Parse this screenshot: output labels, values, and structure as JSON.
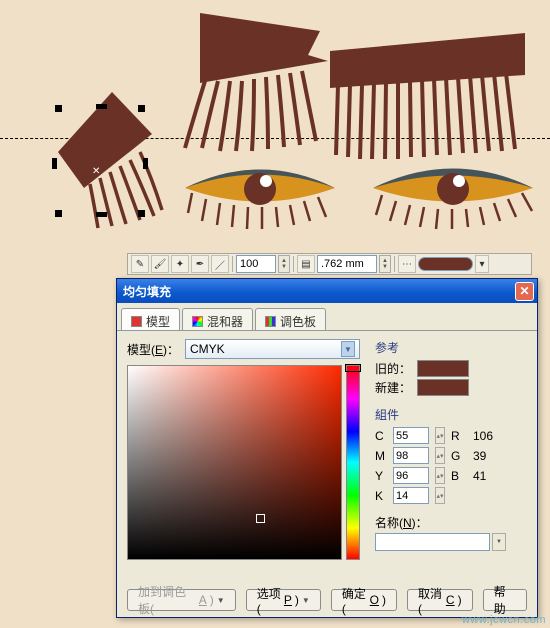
{
  "toolbar": {
    "val1": "100",
    "val2": ".762 mm",
    "swatch_color": "#6a3227"
  },
  "dialog": {
    "title": "均匀填充",
    "tabs": {
      "model": "模型",
      "mixer": "混和器",
      "palette": "调色板"
    },
    "model_label": "模型(E)：",
    "model_value": "CMYK",
    "ref_section": "参考",
    "old_label": "旧的：",
    "new_label": "新建：",
    "comp_section": "組件",
    "c_label": "C",
    "c_val": "55",
    "m_label": "M",
    "m_val": "98",
    "y_label": "Y",
    "y_val": "96",
    "k_label": "K",
    "k_val": "14",
    "r_label": "R",
    "r_val": "106",
    "g_label": "G",
    "g_val": "39",
    "b_label": "B",
    "b_val": "41",
    "name_label": "名称(N)：",
    "btn_addpalette": "加到调色板(A)",
    "btn_options": "选项(P)",
    "btn_ok": "确定(O)",
    "btn_cancel": "取消(C)",
    "btn_help": "帮助"
  },
  "watermark": "www.jcwcn.com"
}
